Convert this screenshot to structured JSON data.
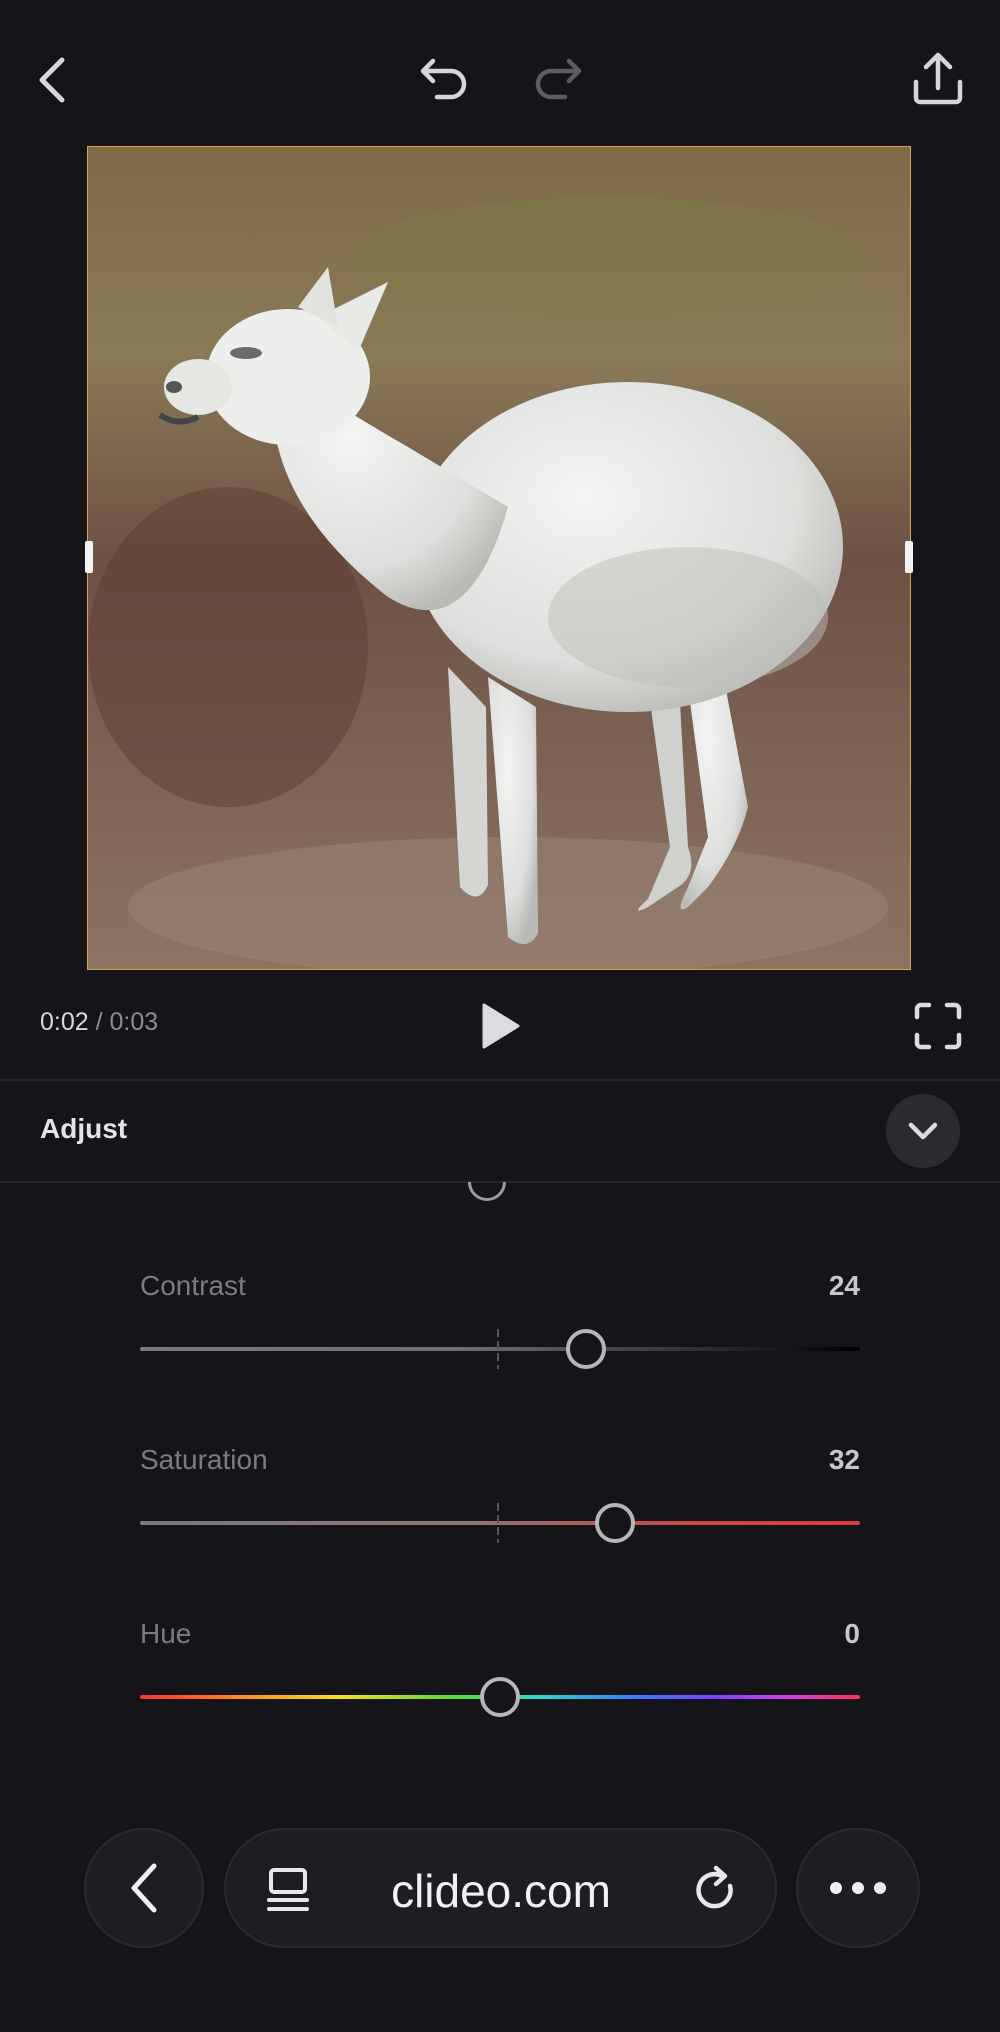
{
  "editor": {
    "time_current": "0:02",
    "time_separator": " / ",
    "time_duration": "0:03"
  },
  "panel": {
    "title": "Adjust"
  },
  "sliders": [
    {
      "label": "Contrast",
      "value": "24",
      "position": 0.62
    },
    {
      "label": "Saturation",
      "value": "32",
      "position": 0.66
    },
    {
      "label": "Hue",
      "value": "0",
      "position": 0.5
    }
  ],
  "browser": {
    "url": "clideo.com"
  },
  "icons": {
    "back": "chevron-left-icon",
    "undo": "undo-icon",
    "redo": "redo-icon",
    "share": "share-icon",
    "play": "play-icon",
    "fullscreen": "fullscreen-icon",
    "collapse": "chevron-down-icon",
    "tabs": "tabs-icon",
    "reload": "reload-icon",
    "more": "more-dots-icon"
  }
}
